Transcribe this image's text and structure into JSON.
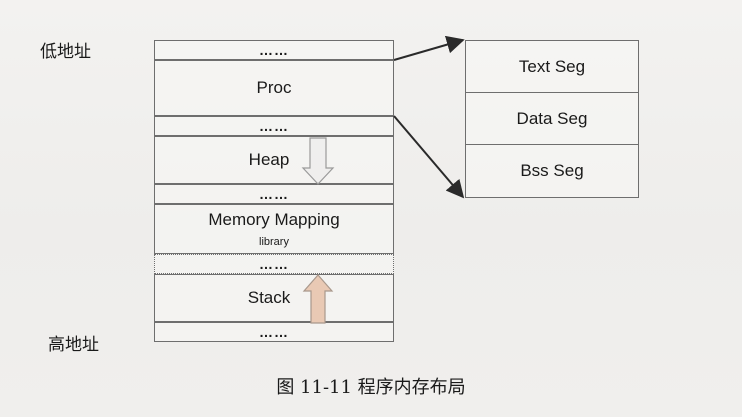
{
  "addresses": {
    "low": "低地址",
    "high": "高地址"
  },
  "memory_layout": [
    {
      "label": "……"
    },
    {
      "label": "Proc"
    },
    {
      "label": "……"
    },
    {
      "label": "Heap"
    },
    {
      "label": "……"
    },
    {
      "label": "Memory Mapping",
      "sublabel": "library"
    },
    {
      "label": "……"
    },
    {
      "label": "Stack"
    },
    {
      "label": "……"
    }
  ],
  "proc_sections": [
    "Text Seg",
    "Data Seg",
    "Bss Seg"
  ],
  "caption": "图 11-11   程序内存布局"
}
